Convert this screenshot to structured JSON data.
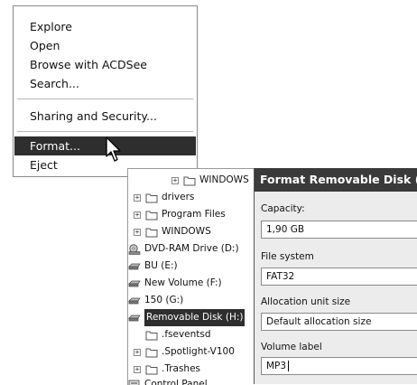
{
  "context_menu": {
    "items": [
      {
        "label": "Explore"
      },
      {
        "label": "Open"
      },
      {
        "label": "Browse with ACDSee"
      },
      {
        "label": "Search..."
      },
      {
        "label": "Sharing and Security..."
      },
      {
        "label": "Format..."
      },
      {
        "label": "Eject"
      }
    ],
    "highlighted": "Format..."
  },
  "tree": {
    "items": [
      {
        "label": "WINDOWS",
        "icon": "folder-icon",
        "expander": "+"
      },
      {
        "label": "drivers",
        "icon": "folder-icon",
        "expander": "+"
      },
      {
        "label": "Program Files",
        "icon": "folder-icon",
        "expander": "+"
      },
      {
        "label": "WINDOWS",
        "icon": "folder-icon",
        "expander": "+"
      },
      {
        "label": "DVD-RAM Drive (D:)",
        "icon": "dvd-drive-icon",
        "expander": ""
      },
      {
        "label": "BU (E:)",
        "icon": "drive-icon",
        "expander": ""
      },
      {
        "label": "New Volume (F:)",
        "icon": "drive-icon",
        "expander": ""
      },
      {
        "label": "150  (G:)",
        "icon": "drive-icon",
        "expander": ""
      },
      {
        "label": "Removable Disk (H:)",
        "icon": "drive-icon",
        "expander": ""
      },
      {
        "label": ".fseventsd",
        "icon": "folder-icon",
        "expander": ""
      },
      {
        "label": ".Spotlight-V100",
        "icon": "folder-icon",
        "expander": "+"
      },
      {
        "label": ".Trashes",
        "icon": "folder-icon",
        "expander": "+"
      },
      {
        "label": "Control Panel",
        "icon": "control-panel-icon",
        "expander": ""
      }
    ]
  },
  "dialog": {
    "title": "Format Removable Disk (H:",
    "capacity_label": "Capacity:",
    "capacity_value": "1,90 GB",
    "filesystem_label": "File system",
    "filesystem_value": "FAT32",
    "allocation_label": "Allocation unit size",
    "allocation_value": "Default allocation size",
    "volume_label_label": "Volume label",
    "volume_label_value": "MP3"
  }
}
